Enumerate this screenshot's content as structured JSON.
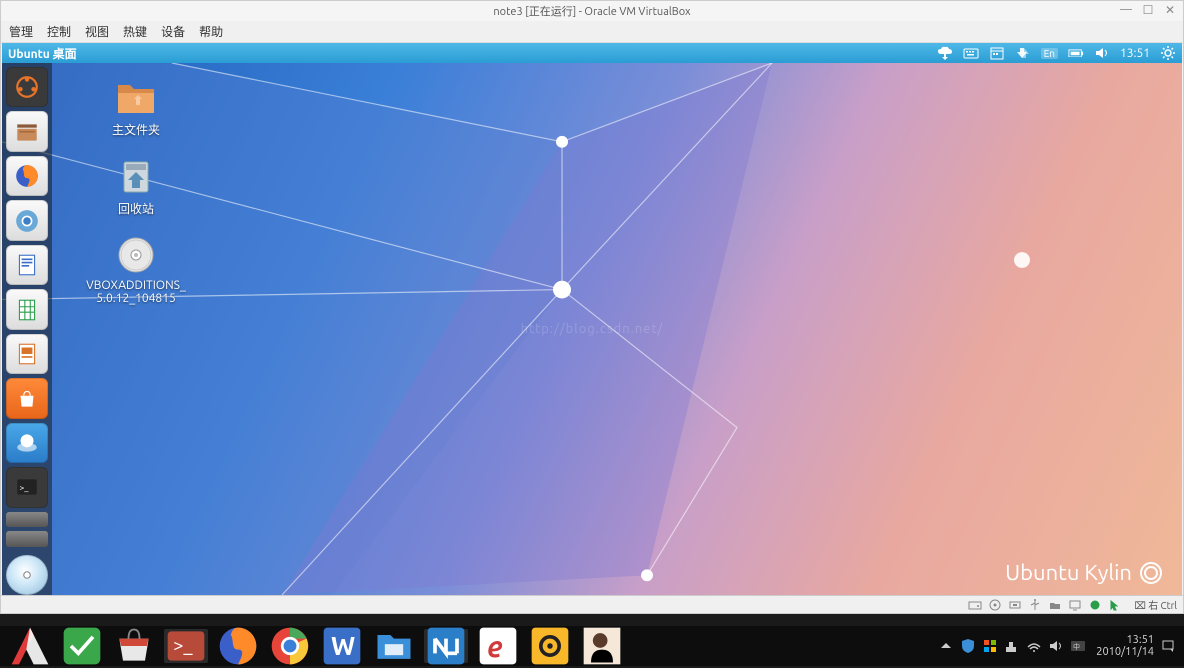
{
  "vbox": {
    "title": "note3 [正在运行] - Oracle VM VirtualBox",
    "menu": {
      "manage": "管理",
      "control": "控制",
      "view": "视图",
      "hotkeys": "热键",
      "devices": "设备",
      "help": "帮助"
    },
    "hostkey": "右 Ctrl"
  },
  "ubuntu": {
    "topbar_title": "Ubuntu 桌面",
    "lang": "En",
    "time": "13:51",
    "brand": "Ubuntu Kylin",
    "watermark": "http://blog.csdn.net/"
  },
  "desktop_icons": {
    "home": "主文件夹",
    "trash": "回收站",
    "additions_line1": "VBOXADDITIONS_",
    "additions_line2": "5.0.12_104815"
  },
  "host": {
    "time": "13:51",
    "date": "2010/11/14"
  }
}
